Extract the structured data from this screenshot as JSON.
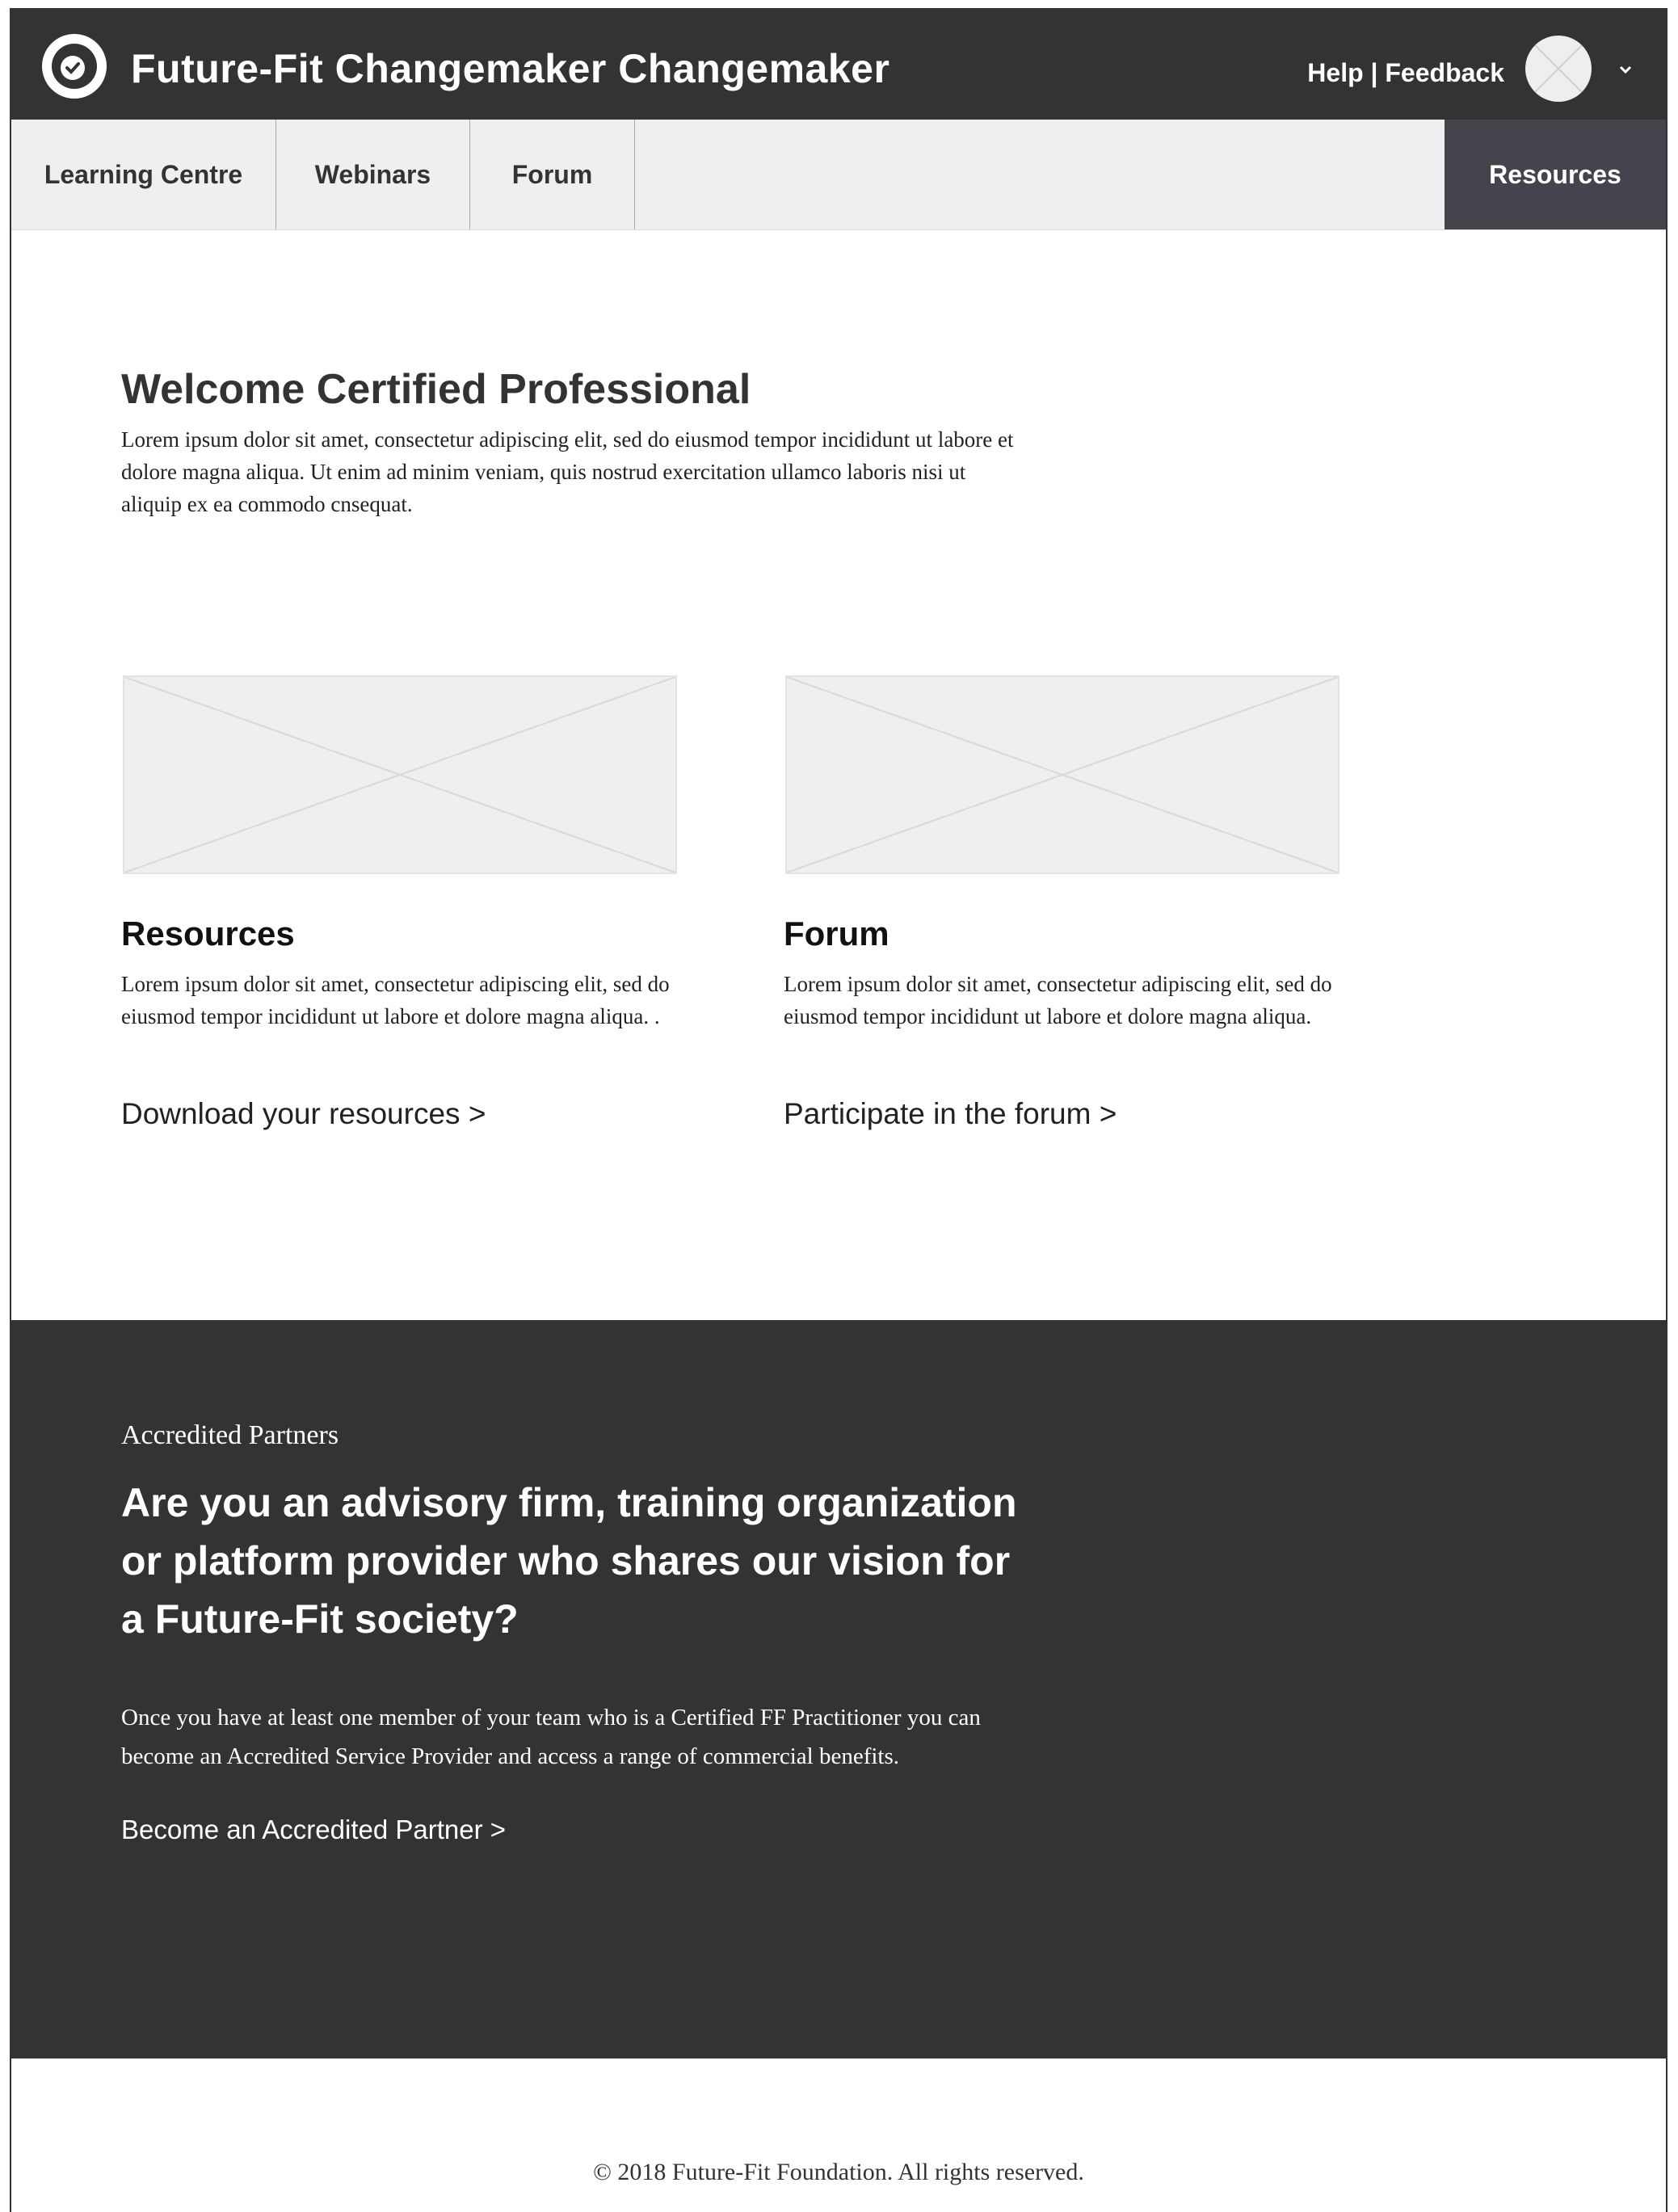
{
  "header": {
    "title": "Future-Fit Changemaker Changemaker",
    "help_label": "Help",
    "separator": "|",
    "feedback_label": "Feedback"
  },
  "nav": {
    "items": [
      {
        "label": "Learning Centre"
      },
      {
        "label": "Webinars"
      },
      {
        "label": "Forum"
      }
    ],
    "active_item": "Resources"
  },
  "welcome": {
    "title": "Welcome Certified Professional",
    "text": "Lorem ipsum dolor sit amet, consectetur adipiscing elit, sed do eiusmod tempor incididunt ut labore et dolore magna aliqua. Ut enim ad minim veniam, quis nostrud exercitation ullamco laboris nisi ut aliquip ex ea commodo cnsequat."
  },
  "cards": [
    {
      "title": "Resources",
      "text": "Lorem ipsum dolor sit amet, consectetur adipiscing elit, sed do eiusmod tempor incididunt ut labore et dolore magna aliqua. .",
      "link": "Download your resources >"
    },
    {
      "title": "Forum",
      "text": "Lorem ipsum dolor sit amet, consectetur adipiscing elit, sed do eiusmod tempor incididunt ut labore et dolore magna aliqua.",
      "link": "Participate in the forum >"
    }
  ],
  "partners": {
    "eyebrow": "Accredited Partners",
    "heading": "Are you an advisory firm, training organization or platform provider who shares our vision for a Future-Fit society?",
    "text": "Once you have at least one member of your team who is a Certified FF Practitioner you can become an Accredited Service Provider and access a range of commercial benefits.",
    "link": "Become an Accredited Partner >"
  },
  "footer": {
    "copyright": "© 2018 Future-Fit Foundation. All rights reserved."
  },
  "icons": {
    "logo": "logo-check-icon",
    "avatar": "avatar-placeholder-icon",
    "chevron": "chevron-down-icon"
  },
  "colors": {
    "header_bg": "#333333",
    "nav_bg": "#efefef",
    "nav_active_bg": "#44444c",
    "placeholder_bg": "#efefef"
  }
}
